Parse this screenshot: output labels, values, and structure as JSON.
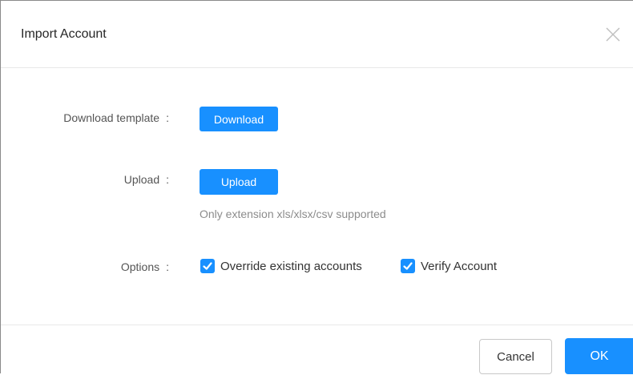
{
  "dialog": {
    "title": "Import Account",
    "close_icon": "close-icon"
  },
  "form": {
    "download": {
      "label": "Download template",
      "colon": ":",
      "button_label": "Download"
    },
    "upload": {
      "label": "Upload",
      "colon": ":",
      "button_label": "Upload",
      "hint": "Only extension xls/xlsx/csv supported"
    },
    "options": {
      "label": "Options",
      "colon": ":",
      "items": [
        {
          "label": "Override existing accounts",
          "checked": true
        },
        {
          "label": "Verify Account",
          "checked": true
        }
      ]
    }
  },
  "footer": {
    "cancel_label": "Cancel",
    "ok_label": "OK"
  },
  "colors": {
    "primary": "#1890ff"
  }
}
